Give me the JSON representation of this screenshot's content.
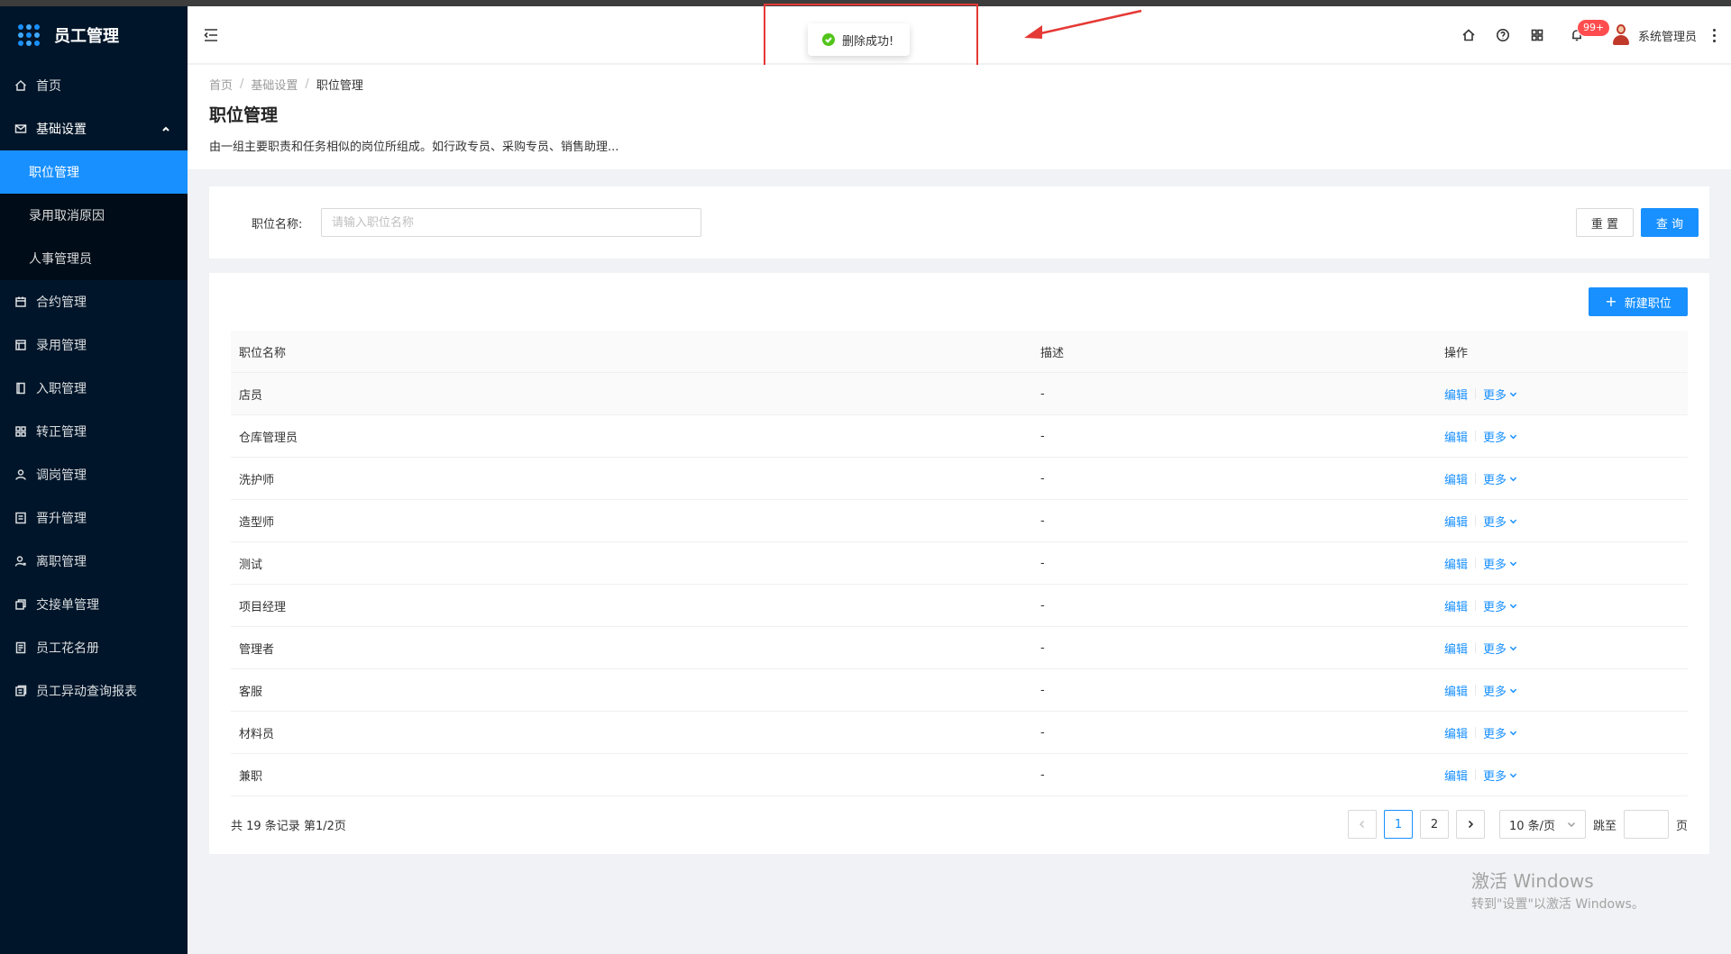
{
  "app": {
    "title": "员工管理"
  },
  "sidebar": {
    "items": [
      {
        "label": "首页",
        "icon": "home-icon"
      },
      {
        "label": "基础设置",
        "icon": "mail-icon",
        "open": true,
        "children": [
          {
            "label": "职位管理",
            "active": true
          },
          {
            "label": "录用取消原因"
          },
          {
            "label": "人事管理员"
          }
        ]
      },
      {
        "label": "合约管理",
        "icon": "calendar-icon"
      },
      {
        "label": "录用管理",
        "icon": "layout-icon"
      },
      {
        "label": "入职管理",
        "icon": "book-icon"
      },
      {
        "label": "转正管理",
        "icon": "grid-icon"
      },
      {
        "label": "调岗管理",
        "icon": "user-icon"
      },
      {
        "label": "晋升管理",
        "icon": "card-icon"
      },
      {
        "label": "离职管理",
        "icon": "user-leave-icon"
      },
      {
        "label": "交接单管理",
        "icon": "copy-icon"
      },
      {
        "label": "员工花名册",
        "icon": "roster-icon"
      },
      {
        "label": "员工异动查询报表",
        "icon": "report-icon"
      }
    ]
  },
  "header": {
    "notification_count": "99+",
    "username": "系统管理员"
  },
  "toast": {
    "message": "删除成功!"
  },
  "breadcrumb": [
    "首页",
    "基础设置",
    "职位管理"
  ],
  "page": {
    "title": "职位管理",
    "description": "由一组主要职责和任务相似的岗位所组成。如行政专员、采购专员、销售助理..."
  },
  "search": {
    "label": "职位名称:",
    "placeholder": "请输入职位名称",
    "reset_label": "重 置",
    "query_label": "查 询"
  },
  "table": {
    "new_button_label": "新建职位",
    "columns": [
      "职位名称",
      "描述",
      "操作"
    ],
    "edit_label": "编辑",
    "more_label": "更多",
    "rows": [
      {
        "name": "店员",
        "desc": "-"
      },
      {
        "name": "仓库管理员",
        "desc": "-"
      },
      {
        "name": "洗护师",
        "desc": "-"
      },
      {
        "name": "造型师",
        "desc": "-"
      },
      {
        "name": "测试",
        "desc": "-"
      },
      {
        "name": "项目经理",
        "desc": "-"
      },
      {
        "name": "管理者",
        "desc": "-"
      },
      {
        "name": "客服",
        "desc": "-"
      },
      {
        "name": "材料员",
        "desc": "-"
      },
      {
        "name": "兼职",
        "desc": "-"
      }
    ]
  },
  "pagination": {
    "total_text": "共 19 条记录 第1/2页",
    "pages": [
      "1",
      "2"
    ],
    "current": "1",
    "page_size": "10 条/页",
    "jump_label": "跳至",
    "page_suffix": "页"
  },
  "watermark": {
    "title": "激活 Windows",
    "subtitle": "转到\"设置\"以激活 Windows。"
  },
  "colors": {
    "primary": "#1890ff",
    "sidebar": "#001529",
    "success": "#52c41a",
    "danger": "#ff4d4f",
    "annotation": "#e53935"
  }
}
